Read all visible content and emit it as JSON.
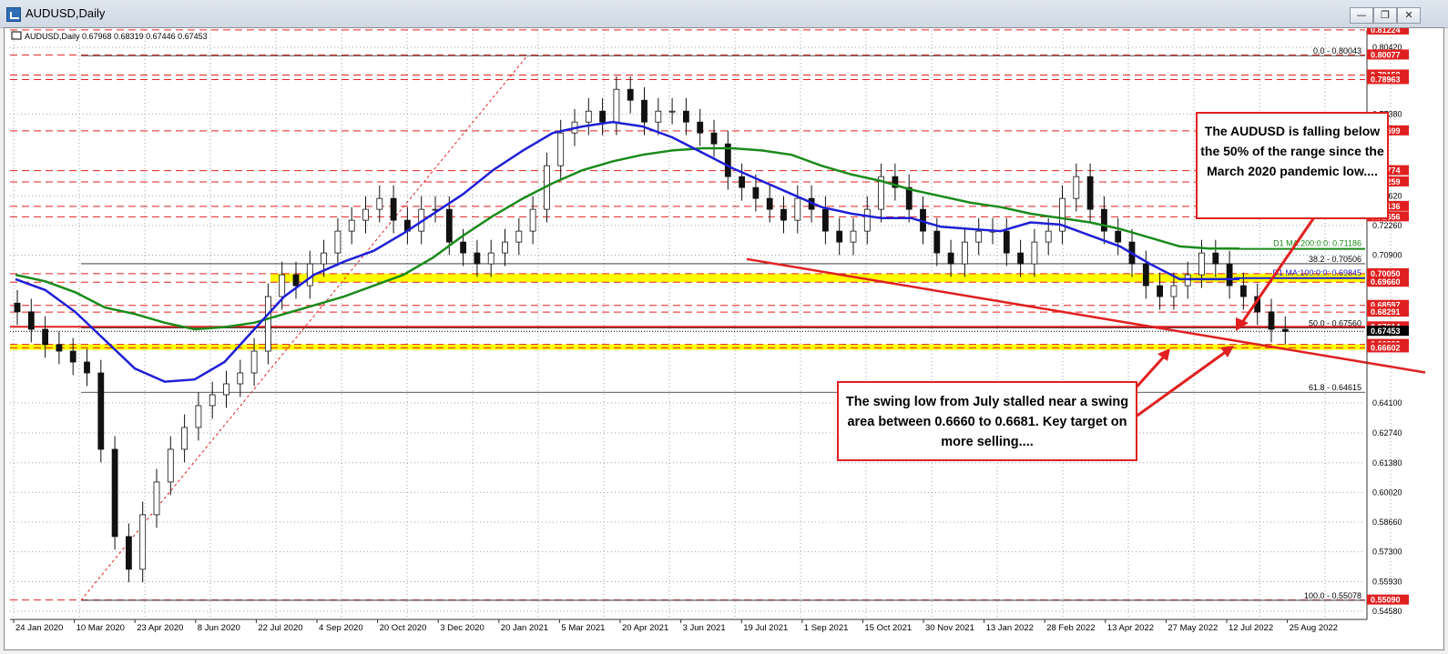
{
  "window": {
    "title": "AUDUSD,Daily",
    "buttons": [
      "minimize",
      "restore",
      "close"
    ]
  },
  "chart_data": {
    "type": "candlestick",
    "symbol_header": "AUDUSD,Daily  0.67968 0.68319 0.67446 0.67453",
    "x_labels": [
      "24 Jan 2020",
      "10 Mar 2020",
      "23 Apr 2020",
      "8 Jun 2020",
      "22 Jul 2020",
      "4 Sep 2020",
      "20 Oct 2020",
      "3 Dec 2020",
      "20 Jan 2021",
      "5 Mar 2021",
      "20 Apr 2021",
      "3 Jun 2021",
      "19 Jul 2021",
      "1 Sep 2021",
      "15 Oct 2021",
      "30 Nov 2021",
      "13 Jan 2022",
      "28 Feb 2022",
      "13 Apr 2022",
      "27 May 2022",
      "12 Jul 2022",
      "25 Aug 2022"
    ],
    "y_ticks": [
      0.8043,
      0.7737,
      0.7362,
      0.7226,
      0.709,
      0.6413,
      0.6275,
      0.6138,
      0.6002,
      0.5866,
      0.573,
      0.5593,
      0.5458
    ],
    "y_tick_labels": [
      "0.80420",
      "0.77380",
      "0.73620",
      "0.72260",
      "0.70900",
      "0.64100",
      "0.62740",
      "0.61380",
      "0.60020",
      "0.58660",
      "0.57300",
      "0.55930",
      "0.54580"
    ],
    "ylim": [
      0.542,
      0.8122
    ],
    "price_levels": [
      {
        "value": 0.81224,
        "label": "0.81224",
        "style": "red-dash"
      },
      {
        "value": 0.80077,
        "label": "0.80077",
        "style": "red-dash"
      },
      {
        "value": 0.79158,
        "label": "0.79158",
        "style": "red-dash"
      },
      {
        "value": 0.7895,
        "label": "0.78963",
        "style": "red-dash"
      },
      {
        "value": 0.76599,
        "label": "0.76599",
        "style": "red-dash"
      },
      {
        "value": 0.74774,
        "label": "0.74774",
        "style": "red-dash"
      },
      {
        "value": 0.74259,
        "label": "0.74259",
        "style": "red-dash"
      },
      {
        "value": 0.73136,
        "label": "0.73136",
        "style": "red-dash"
      },
      {
        "value": 0.72656,
        "label": "0.72656",
        "style": "red-dash"
      },
      {
        "value": 0.7005,
        "label": "0.70050",
        "style": "red-dash"
      },
      {
        "value": 0.6966,
        "label": "0.69660",
        "style": "red-dash"
      },
      {
        "value": 0.68597,
        "label": "0.68597",
        "style": "red-dash"
      },
      {
        "value": 0.6829,
        "label": "0.68291",
        "style": "red-dash"
      },
      {
        "value": 0.67614,
        "label": "0.67614",
        "style": "red-solid"
      },
      {
        "value": 0.6741,
        "label": "0.67453",
        "style": "black-dot"
      },
      {
        "value": 0.6681,
        "label": "0.66809",
        "style": "red-dash"
      },
      {
        "value": 0.6665,
        "label": "0.66602",
        "style": "red-dash"
      },
      {
        "value": 0.5509,
        "label": "0.55090",
        "style": "red-dash"
      }
    ],
    "fibonacci": {
      "levels": [
        {
          "label": "0.0 - 0.80043",
          "value": 0.80043
        },
        {
          "label": "38.2 - 0.70506",
          "value": 0.70506
        },
        {
          "label": "50.0 - 0.67560",
          "value": 0.6756
        },
        {
          "label": "61.8 - 0.64615",
          "value": 0.64615
        },
        {
          "label": "100.0 - 0.55078",
          "value": 0.55078
        }
      ]
    },
    "moving_averages": [
      {
        "name": "D1 MA:200:0:0: 0.71186",
        "color": "#1a8a1a",
        "value": 0.71186
      },
      {
        "name": "D1 MA:100:0:0: 0.69845",
        "color": "#1f1fd6",
        "value": 0.69845
      }
    ],
    "support_zones": [
      {
        "from": 0.6966,
        "to": 0.7005,
        "color": "#ffff00"
      },
      {
        "from": 0.6665,
        "to": 0.6681,
        "color": "#ffff00"
      }
    ],
    "trendline": {
      "from_date": "19 Jul 2021",
      "from_value": 0.7072,
      "to_value": 0.6552,
      "color": "#e02020"
    },
    "series": [
      {
        "name": "price",
        "values": [
          0.683,
          0.675,
          0.668,
          0.665,
          0.66,
          0.655,
          0.62,
          0.58,
          0.565,
          0.59,
          0.605,
          0.62,
          0.63,
          0.64,
          0.645,
          0.65,
          0.655,
          0.665,
          0.69,
          0.7,
          0.695,
          0.705,
          0.71,
          0.72,
          0.725,
          0.73,
          0.735,
          0.725,
          0.72,
          0.73,
          0.73,
          0.715,
          0.71,
          0.705,
          0.71,
          0.715,
          0.72,
          0.73,
          0.75,
          0.765,
          0.77,
          0.775,
          0.77,
          0.785,
          0.78,
          0.77,
          0.775,
          0.775,
          0.77,
          0.765,
          0.76,
          0.745,
          0.74,
          0.735,
          0.73,
          0.725,
          0.735,
          0.73,
          0.72,
          0.715,
          0.72,
          0.73,
          0.745,
          0.74,
          0.73,
          0.72,
          0.71,
          0.705,
          0.715,
          0.72,
          0.72,
          0.71,
          0.705,
          0.715,
          0.72,
          0.735,
          0.745,
          0.73,
          0.72,
          0.715,
          0.705,
          0.695,
          0.69,
          0.695,
          0.7,
          0.71,
          0.705,
          0.695,
          0.69,
          0.683,
          0.675,
          0.674
        ]
      },
      {
        "name": "ma200",
        "values": [
          0.7,
          0.697,
          0.692,
          0.685,
          0.682,
          0.678,
          0.675,
          0.676,
          0.678,
          0.682,
          0.686,
          0.69,
          0.695,
          0.7,
          0.708,
          0.718,
          0.727,
          0.735,
          0.742,
          0.748,
          0.752,
          0.755,
          0.757,
          0.758,
          0.758,
          0.757,
          0.755,
          0.75,
          0.746,
          0.743,
          0.739,
          0.736,
          0.733,
          0.731,
          0.728,
          0.726,
          0.724,
          0.721,
          0.717,
          0.713,
          0.712,
          0.712
        ]
      },
      {
        "name": "ma100",
        "values": [
          0.698,
          0.693,
          0.683,
          0.67,
          0.657,
          0.651,
          0.652,
          0.66,
          0.675,
          0.69,
          0.7,
          0.706,
          0.711,
          0.719,
          0.728,
          0.737,
          0.748,
          0.757,
          0.765,
          0.768,
          0.77,
          0.768,
          0.763,
          0.756,
          0.749,
          0.743,
          0.737,
          0.731,
          0.728,
          0.726,
          0.726,
          0.722,
          0.721,
          0.72,
          0.724,
          0.723,
          0.718,
          0.713,
          0.705,
          0.698,
          0.698,
          0.698
        ]
      }
    ],
    "last_price": {
      "value": 0.67453,
      "label": "0.67453"
    }
  },
  "annotations": {
    "callout_top": "The AUDUSD is falling below the 50% of the range since the March 2020 pandemic low....",
    "callout_bottom": "The swing low from July stalled near a swing area between 0.6660 to 0.6681.  Key target on more selling...."
  }
}
